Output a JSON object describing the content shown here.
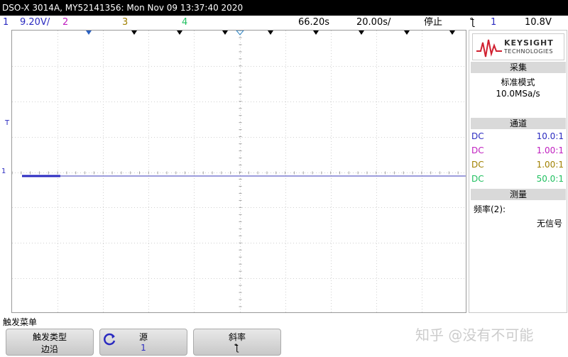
{
  "title": "DSO-X 3014A, MY52141356: Mon Nov 09 13:37:40 2020",
  "status": {
    "ch1_num": "1",
    "ch1_scale": "9.20V/",
    "ch2_num": "2",
    "ch3_num": "3",
    "ch4_num": "4",
    "time_offset": "66.20s",
    "time_scale": "20.00s/",
    "run_state": "停止",
    "trigger_edge": "ƪ",
    "trigger_channel": "1",
    "trigger_level": "10.8V"
  },
  "colors": {
    "ch1": "#2a2ac0",
    "ch2": "#c020c0",
    "ch3": "#a08000",
    "ch4": "#20c060",
    "waveform": "#3a3ab8"
  },
  "markers": {
    "trigger_level": "T",
    "ground": "1"
  },
  "side_panel": {
    "brand": "KEYSIGHT",
    "brand_sub": "TECHNOLOGIES",
    "acq_header": "采集",
    "acq_mode": "标准模式",
    "sample_rate": "10.0MSa/s",
    "channels_header": "通道",
    "channels": [
      {
        "coupling": "DC",
        "ratio": "10.0:1"
      },
      {
        "coupling": "DC",
        "ratio": "1.00:1"
      },
      {
        "coupling": "DC",
        "ratio": "1.00:1"
      },
      {
        "coupling": "DC",
        "ratio": "50.0:1"
      }
    ],
    "measure_header": "测量",
    "measure_label": "频率(2):",
    "measure_value": "无信号"
  },
  "softkeys": {
    "menu_title": "触发菜单",
    "keys": [
      {
        "label": "触发类型",
        "value": "边沿"
      },
      {
        "label": "源",
        "value": "1"
      },
      {
        "label": "斜率",
        "value": "ƪ"
      }
    ]
  },
  "watermark": "知乎 @没有不可能"
}
